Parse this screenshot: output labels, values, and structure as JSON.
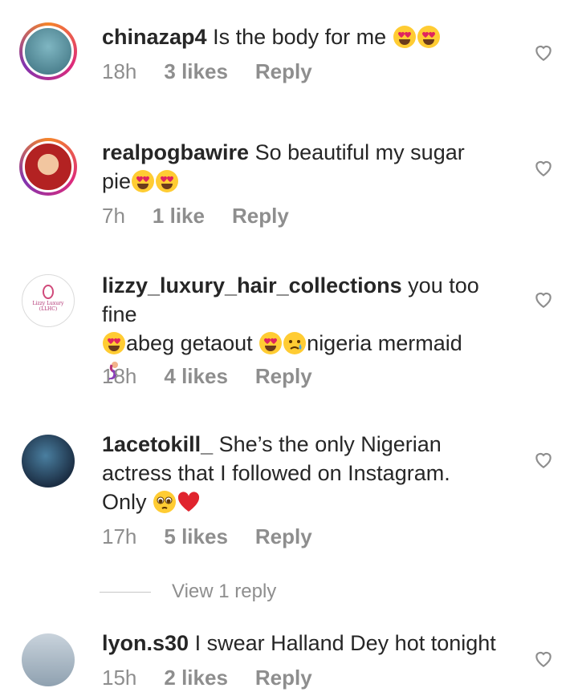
{
  "comments": [
    {
      "username": "chinazap4",
      "text": "Is the body for me",
      "time": "18h",
      "likes": "3 likes",
      "reply": "Reply"
    },
    {
      "username": "realpogbawire",
      "text": "So beautiful my sugar pie",
      "time": "7h",
      "likes": "1 like",
      "reply": "Reply"
    },
    {
      "username": "lizzy_luxury_hair_collections",
      "text_a": "you too fine",
      "text_b": "abeg getaout",
      "text_c": "nigeria mermaid",
      "time": "18h",
      "likes": "4 likes",
      "reply": "Reply"
    },
    {
      "username": "1acetokill_",
      "text": "She’s the only Nigerian actress that I followed on Instagram. Only",
      "time": "17h",
      "likes": "5 likes",
      "reply": "Reply"
    },
    {
      "username": "lyon.s30",
      "text": "I swear Halland Dey hot tonight",
      "time": "15h",
      "likes": "2 likes",
      "reply": "Reply"
    }
  ],
  "view_replies": "View 1 reply",
  "avatar_logo": {
    "line1": "Lizzy Luxury",
    "line2": "(LLHC)"
  },
  "icons": {
    "like": "heart-outline-icon",
    "emoji_love": "heart-eyes-emoji",
    "emoji_cry": "crying-emoji",
    "emoji_plead": "pleading-face-emoji",
    "emoji_heart": "red-heart-emoji",
    "emoji_mermaid": "mermaid-emoji"
  }
}
